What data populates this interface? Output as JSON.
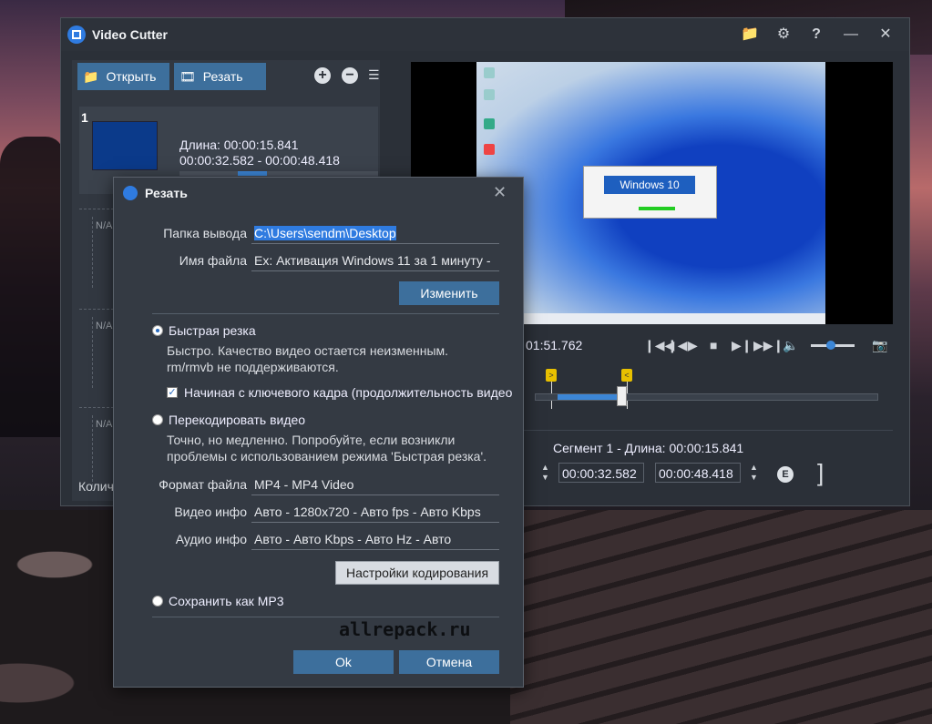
{
  "window": {
    "title": "Video Cutter"
  },
  "toolbar": {
    "open_label": "Открыть",
    "cut_label": "Резать"
  },
  "clip": {
    "number": "1",
    "length": "Длина: 00:00:15.841",
    "range": "00:00:32.582  -  00:00:48.418"
  },
  "slots": [
    "N/A",
    "N/A",
    "N/A"
  ],
  "status": {
    "count_label": "Колич"
  },
  "player": {
    "time": "01:51.762",
    "volume": 0.45,
    "segment_label": "Сегмент 1 - Длина: 00:00:15.841",
    "start_time": "00:00:32.582",
    "end_time": "00:00:48.418",
    "popup_text": "Windows 10"
  },
  "dialog": {
    "title": "Резать",
    "output_folder_label": "Папка вывода",
    "output_folder_value": "C:\\Users\\sendm\\Desktop",
    "filename_label": "Имя файла",
    "filename_value": "Ex: Активация Windows 11 за 1 минуту -",
    "change_button": "Изменить",
    "fast_cut_label": "Быстрая резка",
    "fast_cut_desc_1": "Быстро. Качество видео остается неизменным.",
    "fast_cut_desc_2": "rm/rmvb не поддерживаются.",
    "keyframe_label": "Начиная с ключевого кадра (продолжительность видео",
    "reencode_label": "Перекодировать видео",
    "reencode_desc_1": "Точно, но медленно. Попробуйте, если возникли",
    "reencode_desc_2": "проблемы с использованием режима 'Быстрая резка'.",
    "format_label": "Формат файла",
    "format_value": "MP4 - MP4 Video",
    "video_label": "Видео инфо",
    "video_value": "Авто - 1280x720 - Авто fps - Авто Kbps",
    "audio_label": "Аудио инфо",
    "audio_value": "Авто - Авто Kbps - Авто Hz - Авто",
    "encode_settings_button": "Настройки кодирования",
    "save_mp3_label": "Сохранить как MP3",
    "watermark": "allrepack.ru",
    "ok_button": "Ok",
    "cancel_button": "Отмена"
  },
  "colors": {
    "accent": "#3d6f9c",
    "selection": "#2f7be0",
    "marker": "#e8c000"
  }
}
